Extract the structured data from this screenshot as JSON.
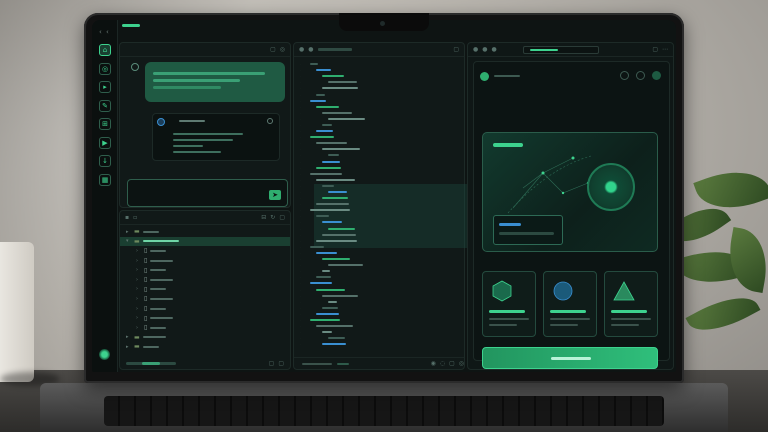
{
  "app": {
    "window_controls": "‹ ‹",
    "accent_color": "#3dd28e",
    "panel_color": "#1f5a43"
  },
  "rail": {
    "items": [
      {
        "icon": "home-icon",
        "glyph": "⌂",
        "active": true
      },
      {
        "icon": "chat-icon",
        "glyph": "◎",
        "active": false
      },
      {
        "icon": "play-icon",
        "glyph": "▸",
        "active": false
      },
      {
        "icon": "edit-icon",
        "glyph": "✎",
        "active": false
      },
      {
        "icon": "grid-icon",
        "glyph": "⊞",
        "active": false
      },
      {
        "icon": "run-icon",
        "glyph": "▶",
        "active": false
      },
      {
        "icon": "arrow-icon",
        "glyph": "↓",
        "active": false
      },
      {
        "icon": "table-icon",
        "glyph": "▦",
        "active": false
      }
    ]
  },
  "chat": {
    "header_title": "",
    "send_glyph": "➤"
  },
  "explorer": {
    "rows": [
      {
        "depth": 0,
        "kind": "folder",
        "caret": "▸",
        "selected": false
      },
      {
        "depth": 0,
        "kind": "folder",
        "caret": "▾",
        "selected": true
      },
      {
        "depth": 1,
        "kind": "file",
        "caret": "›",
        "selected": false
      },
      {
        "depth": 1,
        "kind": "file",
        "caret": "›",
        "selected": false
      },
      {
        "depth": 1,
        "kind": "file",
        "caret": "›",
        "selected": false
      },
      {
        "depth": 1,
        "kind": "file",
        "caret": "›",
        "selected": false
      },
      {
        "depth": 1,
        "kind": "file",
        "caret": "›",
        "selected": false
      },
      {
        "depth": 1,
        "kind": "file",
        "caret": "›",
        "selected": false
      },
      {
        "depth": 1,
        "kind": "file",
        "caret": "›",
        "selected": false
      },
      {
        "depth": 1,
        "kind": "file",
        "caret": "›",
        "selected": false
      },
      {
        "depth": 1,
        "kind": "file",
        "caret": "›",
        "selected": false
      },
      {
        "depth": 0,
        "kind": "folder",
        "caret": "▸",
        "selected": false
      },
      {
        "depth": 0,
        "kind": "folder",
        "caret": "▸",
        "selected": false
      }
    ]
  },
  "preview": {
    "tiles": [
      {
        "icon": "hexagon-icon"
      },
      {
        "icon": "circle-icon"
      },
      {
        "icon": "triangle-icon"
      }
    ]
  }
}
